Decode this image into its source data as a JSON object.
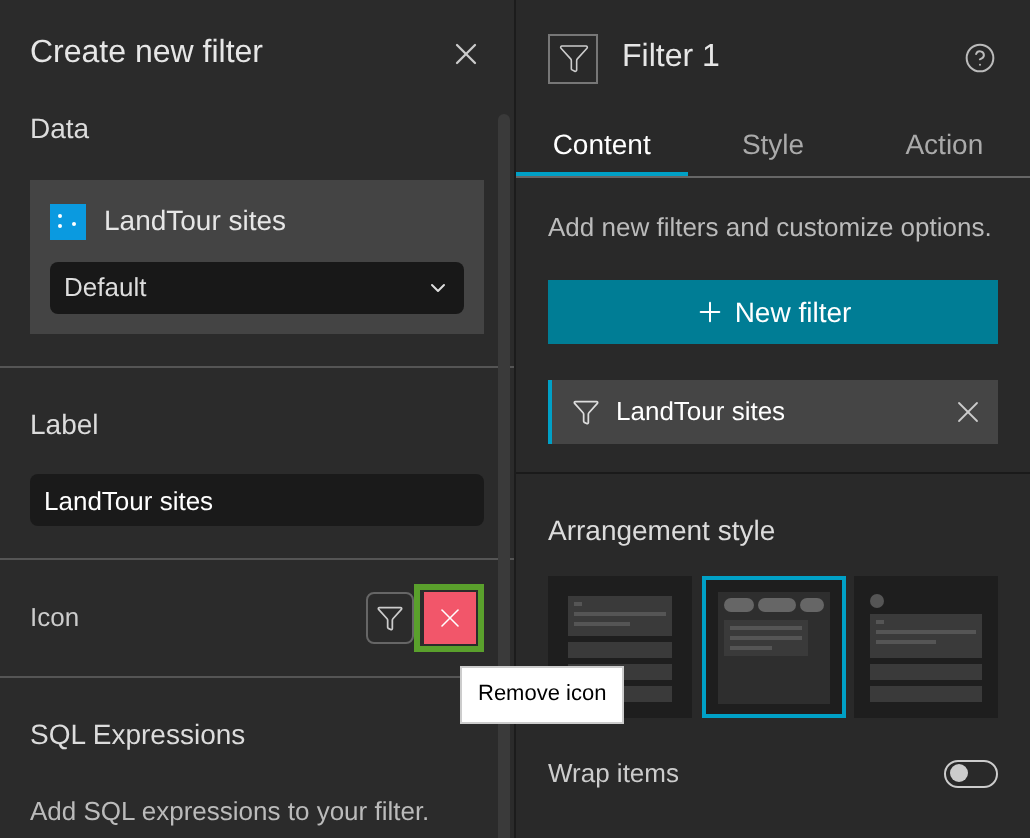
{
  "left_panel": {
    "title": "Create new filter",
    "data_section": {
      "heading": "Data",
      "source": "LandTour sites",
      "view": "Default"
    },
    "label_section": {
      "heading": "Label",
      "value": "LandTour sites"
    },
    "icon_section": {
      "heading": "Icon",
      "tooltip": "Remove icon"
    },
    "sql_section": {
      "heading": "SQL Expressions",
      "description": "Add SQL expressions to your filter."
    }
  },
  "right_panel": {
    "title": "Filter 1",
    "tabs": [
      {
        "label": "Content",
        "selected": true
      },
      {
        "label": "Style",
        "selected": false
      },
      {
        "label": "Action",
        "selected": false
      }
    ],
    "description": "Add new filters and customize options.",
    "new_filter_button": "New filter",
    "filters": [
      {
        "label": "LandTour sites"
      }
    ],
    "arrangement": {
      "heading": "Arrangement style",
      "options": [
        {
          "kind": "block",
          "selected": false
        },
        {
          "kind": "popper",
          "selected": true
        },
        {
          "kind": "icon",
          "selected": false
        }
      ]
    },
    "wrap_items": {
      "label": "Wrap items",
      "on": false
    }
  }
}
